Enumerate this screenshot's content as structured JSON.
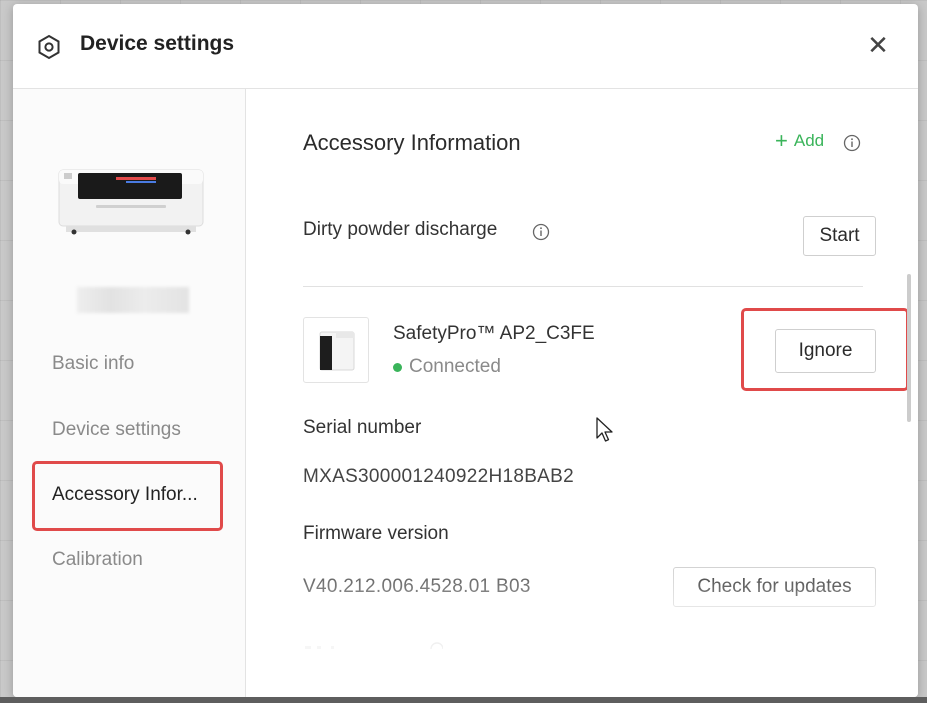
{
  "window": {
    "title": "Device settings",
    "icons": {
      "header": "hexagon-gear-icon",
      "close": "close-icon"
    }
  },
  "sidebar": {
    "device_image": "printer-image",
    "items": [
      {
        "label": "Basic info",
        "active": false
      },
      {
        "label": "Device settings",
        "active": false
      },
      {
        "label": "Accessory Infor...",
        "active": true
      },
      {
        "label": "Calibration",
        "active": false
      }
    ]
  },
  "main": {
    "section_title": "Accessory Information",
    "add_label": "Add",
    "dirty_powder": {
      "label": "Dirty powder discharge",
      "button": "Start"
    },
    "accessory": {
      "name": "SafetyPro™ AP2_C3FE",
      "status": "Connected",
      "status_color": "#3ab45a",
      "ignore_button": "Ignore",
      "image": "air-purifier-image"
    },
    "serial": {
      "label": "Serial number",
      "value": "MXAS300001240922H18BAB2"
    },
    "firmware": {
      "label": "Firmware version",
      "value": "V40.212.006.4528.01 B03",
      "button": "Check for updates"
    }
  },
  "colors": {
    "accent": "#3ab45a",
    "highlight": "#e04a4a"
  }
}
